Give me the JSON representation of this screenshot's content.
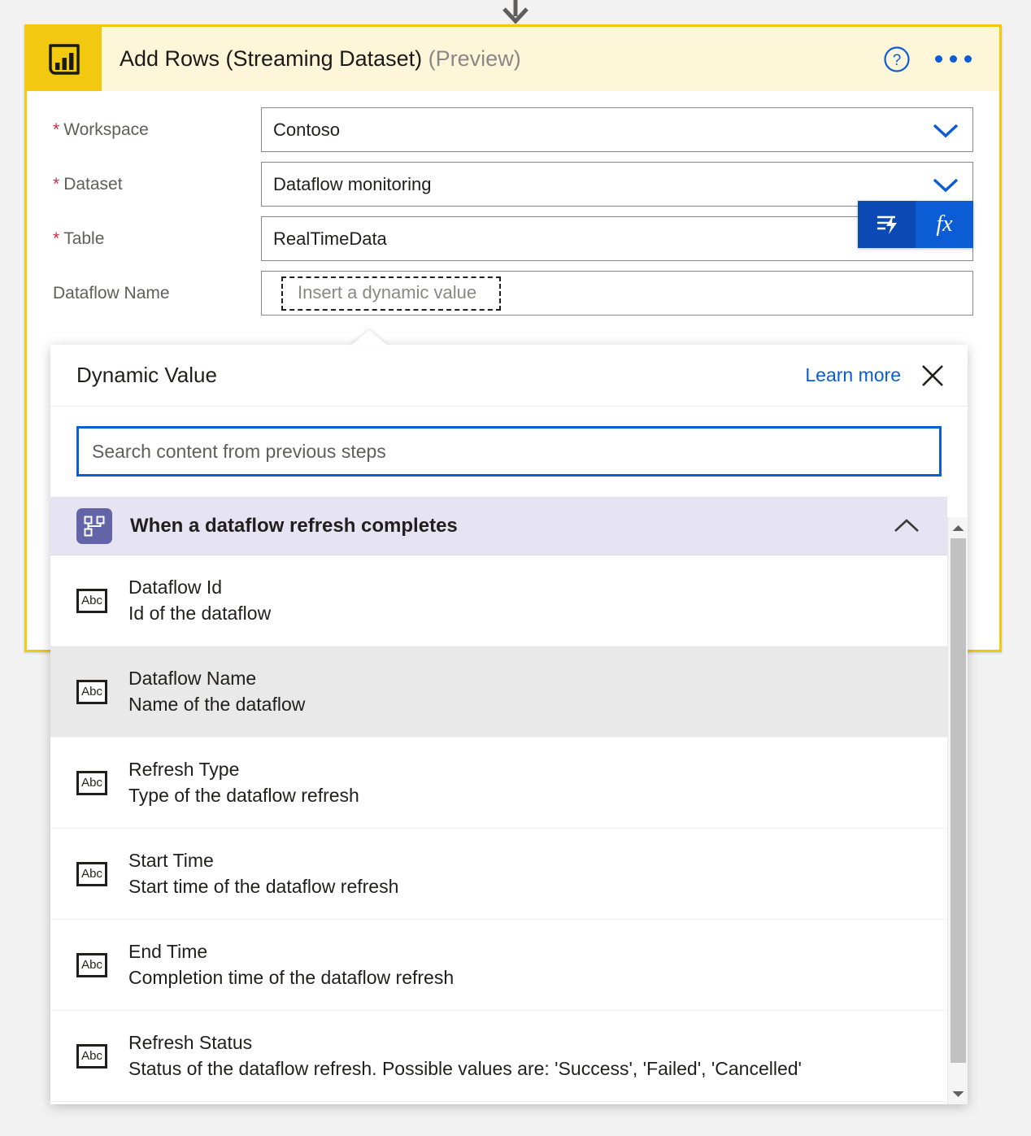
{
  "connector": {
    "icon": "down-arrow-icon"
  },
  "action_card": {
    "logo_icon": "power-bi-icon",
    "title": "Add Rows (Streaming Dataset)",
    "title_suffix": "(Preview)",
    "help_icon": "help-circle-icon",
    "more_icon": "more-ellipsis-icon",
    "fields": [
      {
        "label": "Workspace",
        "required": true,
        "value": "Contoso",
        "control": "dropdown",
        "chevron_icon": "chevron-down-icon"
      },
      {
        "label": "Dataset",
        "required": true,
        "value": "Dataflow monitoring",
        "control": "dropdown",
        "chevron_icon": "chevron-down-icon"
      },
      {
        "label": "Table",
        "required": true,
        "value": "RealTimeData",
        "control": "text",
        "dynamic_content_icon": "dynamic-content-lightning-icon",
        "expression_icon": "fx",
        "expression_label": "fx"
      },
      {
        "label": "Dataflow Name",
        "required": false,
        "value": "",
        "control": "dynamic",
        "placeholder": "Insert a dynamic value"
      }
    ]
  },
  "dynamic_panel": {
    "title": "Dynamic Value",
    "learn_more_label": "Learn more",
    "close_icon": "close-icon",
    "search": {
      "value": "",
      "placeholder": "Search content from previous steps"
    },
    "group": {
      "icon": "dataflow-trigger-icon",
      "label": "When a dataflow refresh completes",
      "expanded": true,
      "collapse_icon": "chevron-up-icon"
    },
    "items": [
      {
        "icon": "abc-text-icon",
        "icon_label": "Abc",
        "title": "Dataflow Id",
        "description": "Id of the dataflow",
        "hovered": false
      },
      {
        "icon": "abc-text-icon",
        "icon_label": "Abc",
        "title": "Dataflow Name",
        "description": "Name of the dataflow",
        "hovered": true
      },
      {
        "icon": "abc-text-icon",
        "icon_label": "Abc",
        "title": "Refresh Type",
        "description": "Type of the dataflow refresh",
        "hovered": false
      },
      {
        "icon": "abc-text-icon",
        "icon_label": "Abc",
        "title": "Start Time",
        "description": "Start time of the dataflow refresh",
        "hovered": false
      },
      {
        "icon": "abc-text-icon",
        "icon_label": "Abc",
        "title": "End Time",
        "description": "Completion time of the dataflow refresh",
        "hovered": false
      },
      {
        "icon": "abc-text-icon",
        "icon_label": "Abc",
        "title": "Refresh Status",
        "description": "Status of the dataflow refresh. Possible values are: 'Success', 'Failed', 'Cancelled'",
        "hovered": false
      }
    ],
    "scrollbar": {
      "up_icon": "scroll-up-arrow-icon",
      "down_icon": "scroll-down-arrow-icon"
    }
  },
  "colors": {
    "brand_yellow": "#f2c811",
    "header_yellow": "#fdf6d9",
    "accent_blue": "#0b5cd5",
    "required_red": "#c4314b",
    "group_purple": "#6264a7",
    "group_row_bg": "#e6e4f2",
    "page_bg": "#f2f2f2"
  }
}
